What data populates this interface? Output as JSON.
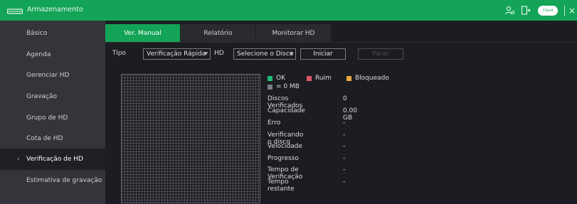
{
  "header": {
    "title": "Armazenamento",
    "cloud_label": "Cloud",
    "close_glyph": "×",
    "colors": {
      "topbar": "#14a457"
    }
  },
  "sidebar": {
    "items": [
      {
        "label": "Básico"
      },
      {
        "label": "Agenda"
      },
      {
        "label": "Gerenciar HD"
      },
      {
        "label": "Gravação"
      },
      {
        "label": "Grupo de HD"
      },
      {
        "label": "Cota de HD"
      },
      {
        "label": "Verificação de HD",
        "active": true
      },
      {
        "label": "Estimativa de gravação"
      }
    ]
  },
  "tabs": [
    {
      "label": "Ver. Manual",
      "active": true
    },
    {
      "label": "Relatório"
    },
    {
      "label": "Monitorar HD"
    }
  ],
  "controls": {
    "tipo_label": "Tipo",
    "tipo_value": "Verificação Rápida",
    "hd_label": "HD",
    "hd_value": "Selecione o Disco",
    "start_label": "Iniciar",
    "stop_label": "Parar"
  },
  "legend": {
    "ok": "OK",
    "bad": "Ruim",
    "blocked": "Bloqueado",
    "scale": "= 0 MB",
    "colors": {
      "ok": "#1dbb72",
      "bad": "#e0566a",
      "blocked": "#e9a93a",
      "scale": "#7a7b80"
    }
  },
  "info": [
    {
      "key": "Discos Verificados",
      "value": "0"
    },
    {
      "key": "Capacidade",
      "value": "0.00 GB"
    },
    {
      "key": "Erro",
      "value": "-"
    },
    {
      "key": "Verificando o disco",
      "value": "-"
    },
    {
      "key": "Velocidade",
      "value": "-"
    },
    {
      "key": "Progresso",
      "value": "-"
    },
    {
      "key": "Tempo de Verificação",
      "value": "-"
    },
    {
      "key": "Tempo restante",
      "value": "-"
    }
  ]
}
